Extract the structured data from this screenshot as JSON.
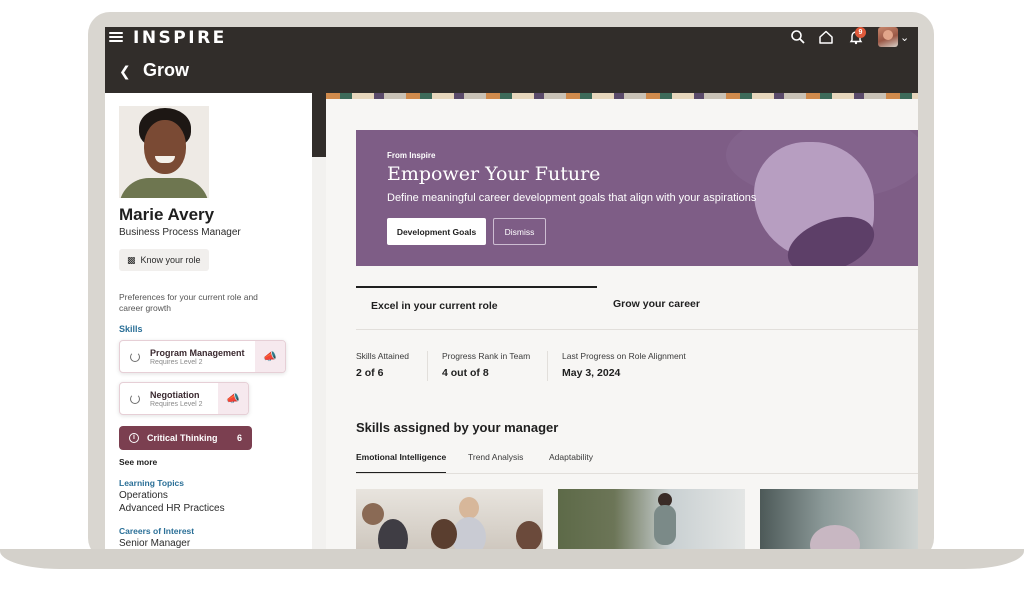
{
  "app": {
    "brand": "INSPIRE",
    "notification_count": "9"
  },
  "page": {
    "title": "Grow"
  },
  "profile": {
    "name": "Marie Avery",
    "role": "Business Process Manager",
    "know_role_label": "Know your role",
    "preferences_text": "Preferences for your current role and career growth"
  },
  "skills": {
    "label": "Skills",
    "items": [
      {
        "name": "Program Management",
        "sub": "Requires Level 2"
      },
      {
        "name": "Negotiation",
        "sub": "Requires Level 2"
      }
    ],
    "active": {
      "name": "Critical Thinking",
      "count": "6"
    },
    "see_more": "See more"
  },
  "learning_topics": {
    "label": "Learning Topics",
    "items": [
      "Operations",
      "Advanced HR Practices"
    ]
  },
  "careers": {
    "label": "Careers of Interest",
    "items": [
      "Senior Manager"
    ]
  },
  "hero": {
    "eyebrow": "From Inspire",
    "title": "Empower Your Future",
    "subtitle": "Define meaningful career development goals that align with your aspirations",
    "primary_button": "Development Goals",
    "secondary_button": "Dismiss"
  },
  "role_tabs": [
    "Excel in your current role",
    "Grow your career"
  ],
  "stats": [
    {
      "label": "Skills Attained",
      "value": "2 of 6"
    },
    {
      "label": "Progress Rank in Team",
      "value": "4 out of 8"
    },
    {
      "label": "Last Progress on Role Alignment",
      "value": "May 3, 2024"
    }
  ],
  "manager_skills": {
    "title": "Skills assigned by your manager",
    "tabs": [
      "Emotional Intelligence",
      "Trend Analysis",
      "Adaptability"
    ]
  }
}
